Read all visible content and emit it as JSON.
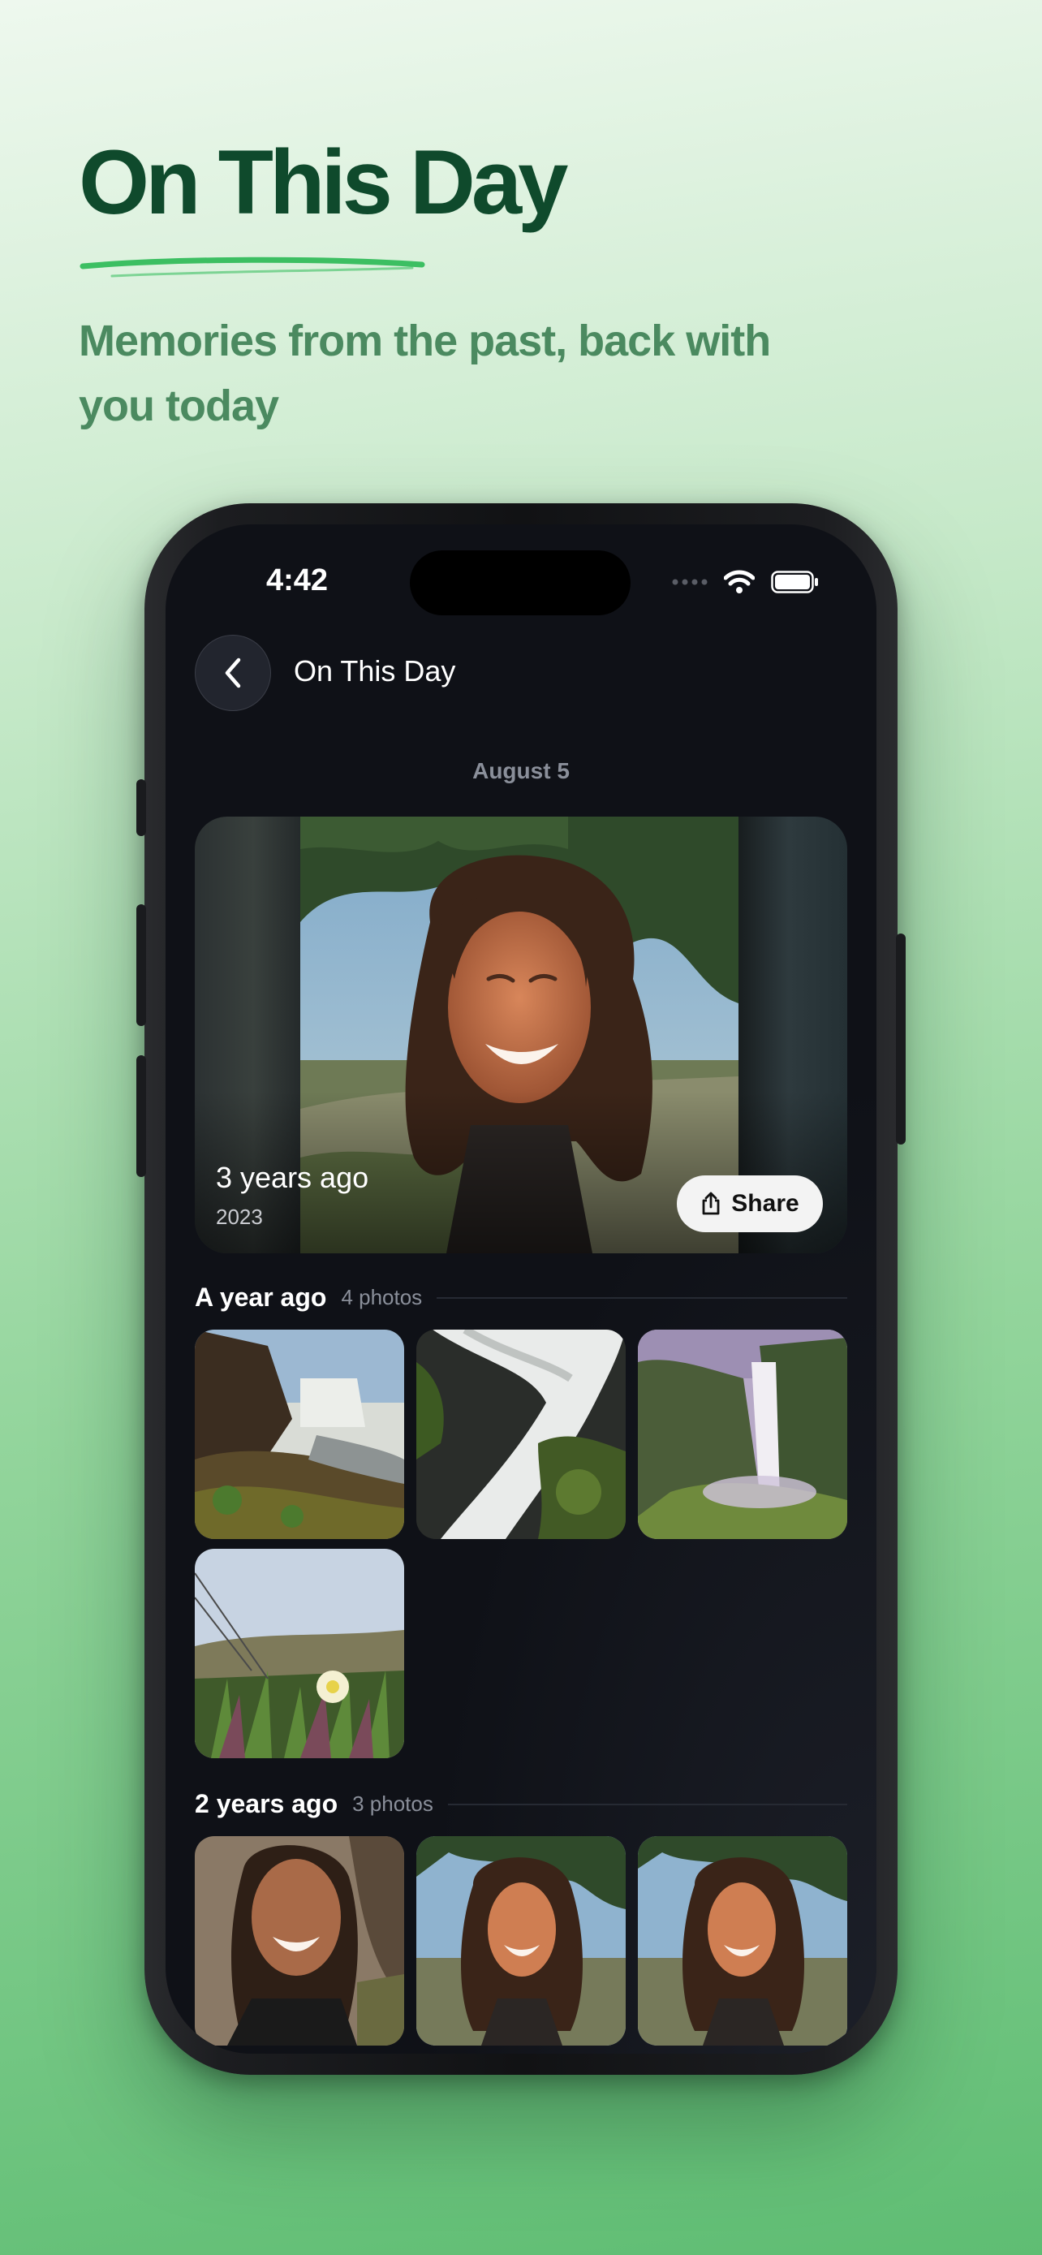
{
  "hero": {
    "title": "On This Day",
    "subtitle": "Memories from the past, back with you today"
  },
  "status_bar": {
    "time": "4:42",
    "icons": [
      "signal-dots-icon",
      "wifi-icon",
      "battery-icon"
    ]
  },
  "nav": {
    "back_icon": "chevron-left-icon",
    "title": "On This Day"
  },
  "date_label": "August 5",
  "featured": {
    "title": "3 years ago",
    "year": "2023",
    "share_label": "Share",
    "share_icon": "share-icon"
  },
  "sections": [
    {
      "title": "A year ago",
      "count": "4 photos"
    },
    {
      "title": "2 years ago",
      "count": "3 photos"
    }
  ],
  "colors": {
    "hero_title": "#0f4a2c",
    "hero_subtitle": "#4b8a60",
    "underline": "#3cbf62",
    "screen_bg": "#0f1117"
  }
}
